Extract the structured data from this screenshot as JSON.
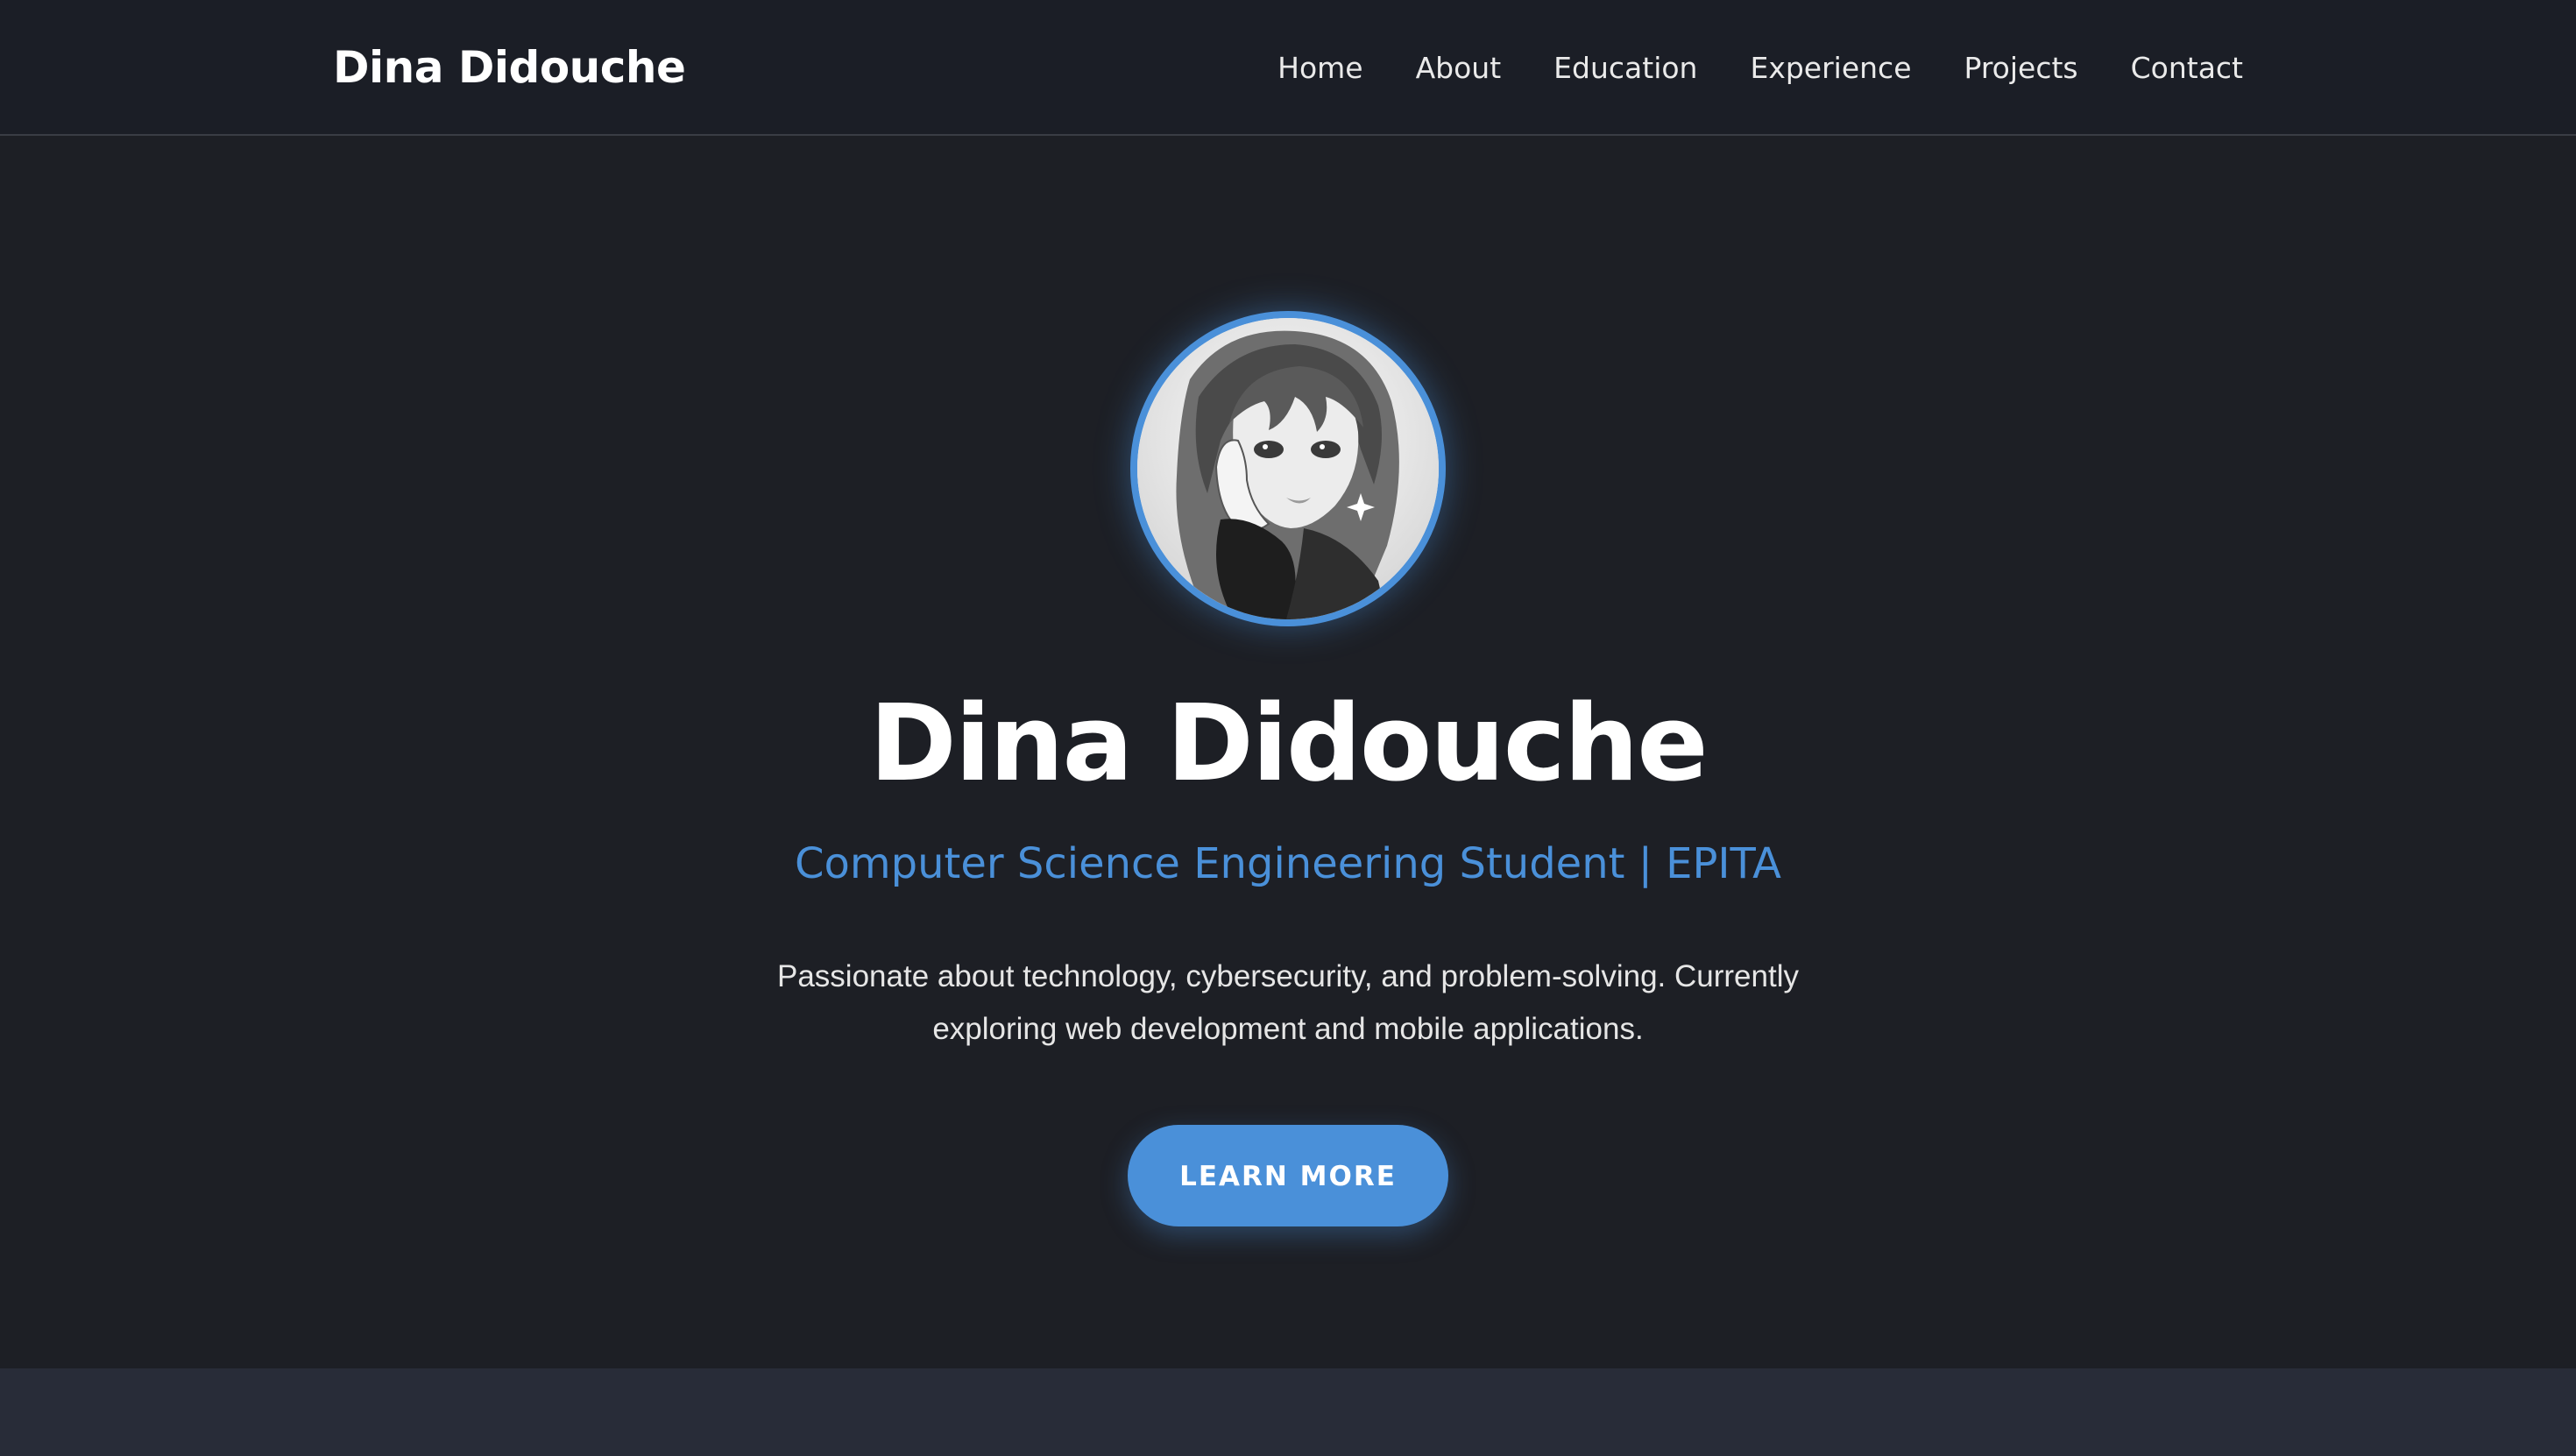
{
  "nav": {
    "brand": "Dina Didouche",
    "links": [
      "Home",
      "About",
      "Education",
      "Experience",
      "Projects",
      "Contact"
    ]
  },
  "hero": {
    "name": "Dina Didouche",
    "subtitle": "Computer Science Engineering Student | EPITA",
    "description": "Passionate about technology, cybersecurity, and problem-solving. Currently exploring web development and mobile applications.",
    "cta_label": "LEARN MORE",
    "avatar_icon": "profile-illustration"
  },
  "colors": {
    "accent": "#4a90d9",
    "background": "#1d1f25",
    "navbar": "#1b1e26",
    "section_alt": "#282c38"
  }
}
